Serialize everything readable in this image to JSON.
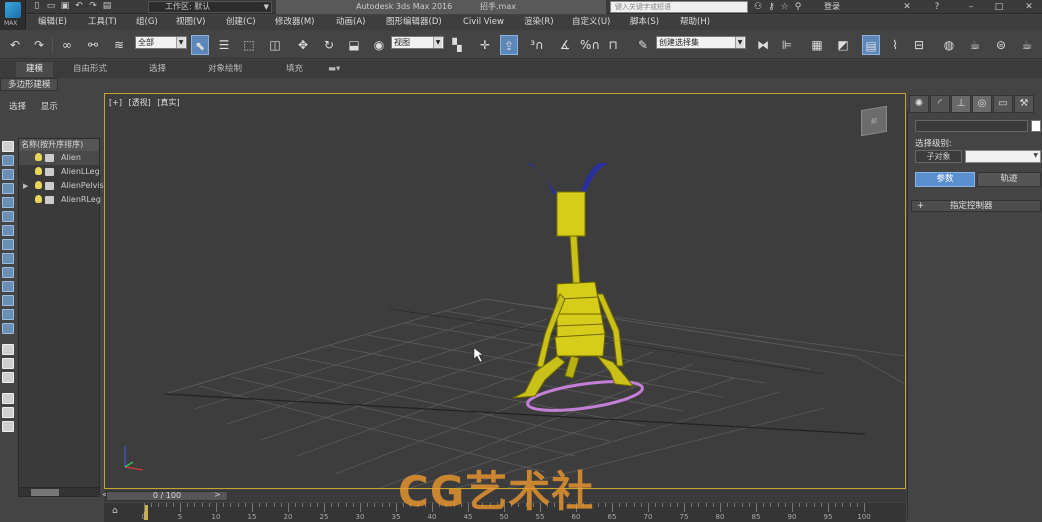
{
  "titlebar": {
    "logo_text": "MAX",
    "workspace_label": "工作区: 默认",
    "app_title": "Autodesk 3ds Max 2016",
    "file_name": "招手.max",
    "search_placeholder": "键入关键字或短语",
    "login_label": "登录"
  },
  "menu": [
    "编辑(E)",
    "工具(T)",
    "组(G)",
    "视图(V)",
    "创建(C)",
    "修改器(M)",
    "动画(A)",
    "图形编辑器(D)",
    "Civil View",
    "渲染(R)",
    "自定义(U)",
    "脚本(S)",
    "帮助(H)"
  ],
  "toolbar": {
    "selection_filter": "全部",
    "ref_coord": "视图",
    "named_selection": "创建选择集"
  },
  "ribbon": {
    "tabs": [
      "建模",
      "自由形式",
      "选择",
      "对象绘制",
      "填充"
    ],
    "active_tab": "建模",
    "panel_label": "多边形建模"
  },
  "scene_explorer": {
    "tabs": [
      "选择",
      "显示"
    ],
    "column_header": "名称(按升序排序)",
    "items": [
      "Alien",
      "AlienLLeg",
      "AlienPelvis",
      "AlienRLeg"
    ]
  },
  "viewport": {
    "labels": [
      "[+]",
      "[透视]",
      "[真实]"
    ],
    "viewcube_label": "前"
  },
  "command_panel": {
    "selection_level_label": "选择级别:",
    "subobject_button": "子对象",
    "params_button": "参数",
    "trajectory_button": "轨迹",
    "rollout_title": "指定控制器",
    "rollout_toggle": "+"
  },
  "timeline": {
    "slider_label": "0 / 100",
    "ticks": [
      0,
      5,
      10,
      15,
      20,
      25,
      30,
      35,
      40,
      45,
      50,
      55,
      60,
      65,
      70,
      75,
      80,
      85,
      90,
      95,
      100
    ]
  },
  "watermark": "CG艺术社",
  "colors": {
    "viewport_border": "#c8a52c",
    "active_blue": "#5a8fd0",
    "mesh_yellow": "#d6cc1a",
    "antenna_blue": "#2a2fa0",
    "path_pink": "#c47fd6"
  }
}
